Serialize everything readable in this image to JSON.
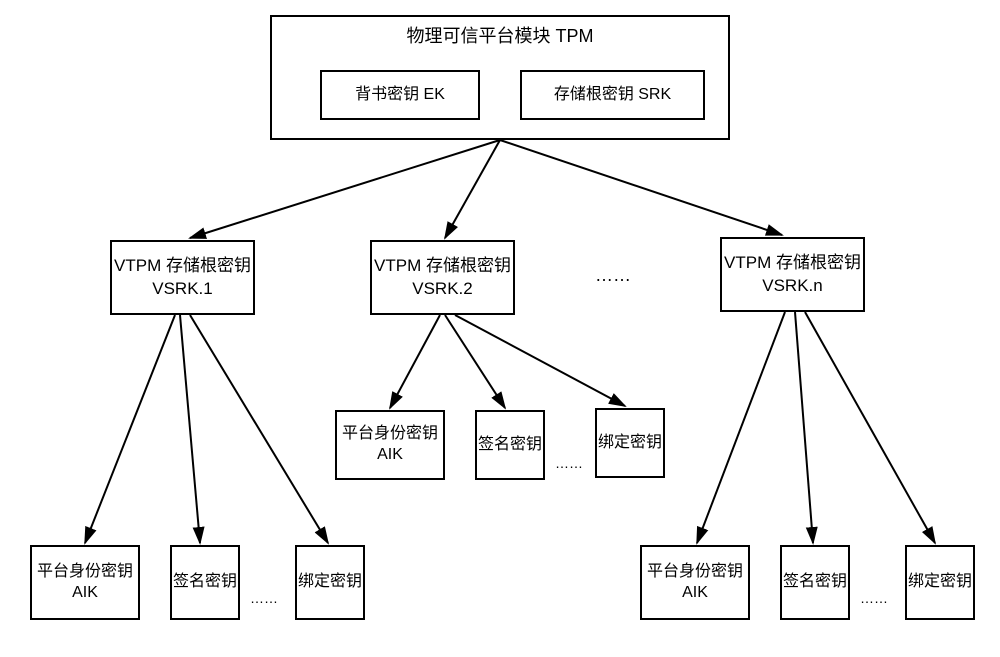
{
  "tpm": {
    "title": "物理可信平台模块 TPM",
    "ek": "背书密钥 EK",
    "srk": "存储根密钥 SRK"
  },
  "vtpm": {
    "v1": "VTPM 存储根密钥 VSRK.1",
    "v2": "VTPM 存储根密钥 VSRK.2",
    "vn": "VTPM 存储根密钥 VSRK.n",
    "ellipsis": "……"
  },
  "leaves": {
    "aik": "平台身份密钥 AIK",
    "sign": "签名密钥",
    "bind": "绑定密钥",
    "ellipsis": "……"
  }
}
